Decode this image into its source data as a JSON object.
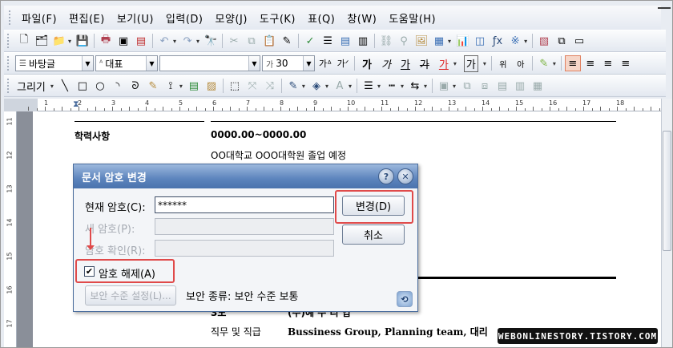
{
  "menu": [
    "파일(F)",
    "편집(E)",
    "보기(U)",
    "입력(D)",
    "모양(J)",
    "도구(K)",
    "표(Q)",
    "창(W)",
    "도움말(H)"
  ],
  "format_toolbar": {
    "style": "바탕글",
    "font": "대표",
    "font_name": "",
    "size": "30",
    "size_tag": "가",
    "format_chars": [
      "가",
      "가",
      "가",
      "가",
      "가",
      "가"
    ]
  },
  "draw_toolbar": {
    "label": "그리기"
  },
  "ruler": {
    "numbers": [
      "1",
      "2",
      "3",
      "4",
      "5",
      "6",
      "7",
      "8",
      "9",
      "10",
      "11",
      "12",
      "13",
      "14",
      "15",
      "16",
      "17",
      "18"
    ],
    "vertical_numbers": [
      "11",
      "12",
      "13",
      "14",
      "15",
      "16",
      "17"
    ]
  },
  "document": {
    "education_label": "학력사항",
    "education_date": "0000.00~0000.00",
    "education_school": "OO대학교 OOO대학원 졸업 예정",
    "partial_row_left": "3도",
    "partial_row_right": "(수)예 수 리 업",
    "position_label": "직무 및 직급",
    "position_value": "Bussiness Group, Planning team, 대리"
  },
  "dialog": {
    "title": "문서 암호 변경",
    "current_label": "현재 암호(C):",
    "current_value": "******",
    "new_label": "새 암호(P):",
    "confirm_label": "암호 확인(R):",
    "change_button": "변경(D)",
    "cancel_button": "취소",
    "release_label": "암호 해제(A)",
    "release_checked": "✔",
    "security_button": "보안 수준 설정(L)...",
    "security_type": "보안 종류:  보안 수준 보통",
    "help_glyph": "?",
    "close_glyph": "✕"
  },
  "watermark": "WEBONLINESTORY.TISTORY.COM"
}
